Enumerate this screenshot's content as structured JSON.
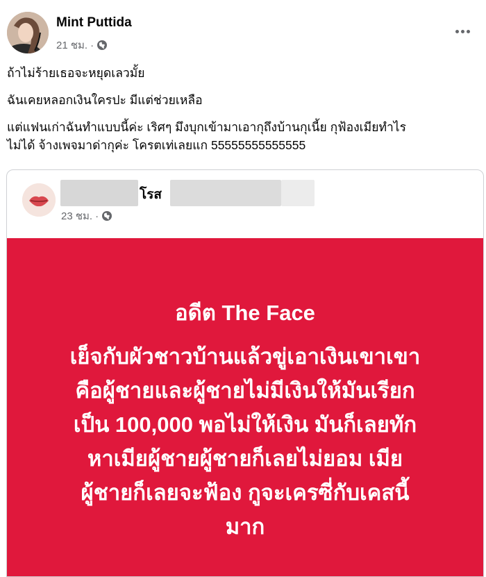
{
  "post": {
    "author": "Mint Puttida",
    "time": "21 ชม.",
    "paragraphs": [
      "ถ้าไม่ร้ายเธอจะหยุดเลวมั้ย",
      "ฉันเคยหลอกเงินใครปะ มีแต่ช่วยเหลือ",
      "แต่แฟนเก่าฉันทำแบบนี้ค่ะ เริศๆ มึงบุกเข้ามาเอากุถึงบ้านกุเนี้ย กุฟ้องเมียทำไร",
      "ไม่ได้ จ้างเพจมาด่ากุค่ะ โครตเท่เลยแก 55555555555555"
    ]
  },
  "shared": {
    "name": "โรส",
    "time": "23 ชม.",
    "headline": "อดีต The Face",
    "body_lines": [
      "เย็จกับผัวชาวบ้านแล้วขู่เอาเงินเขาเขา",
      "คือผู้ชายและผู้ชายไม่มีเงินให้มันเรียก",
      "เป็น 100,000 พอไม่ให้เงิน มันก็เลยทัก",
      "หาเมียผู้ชายผู้ชายก็เลยไม่ยอม เมีย",
      "ผู้ชายก็เลยจะฟ้อง กูจะเครซี่กับเคสนี้",
      "มาก"
    ]
  },
  "colors": {
    "panel_red": "#e0183c",
    "meta_gray": "#65676b"
  },
  "icons": {
    "privacy": "globe-icon",
    "menu": "more-options-icon"
  }
}
